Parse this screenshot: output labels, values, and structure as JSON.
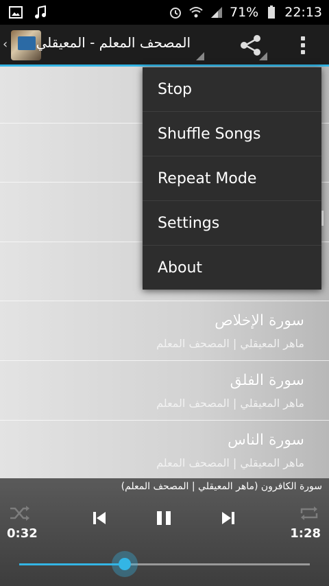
{
  "status_bar": {
    "battery_percent": "71%",
    "time": "22:13",
    "icons": [
      "image-icon",
      "music-note-icon",
      "alarm-icon",
      "wifi-icon",
      "signal-icon",
      "battery-icon"
    ]
  },
  "action_bar": {
    "title": "المصحف المعلم - المعيقلي",
    "share_icon": "share-icon",
    "overflow_icon": "overflow-menu-icon"
  },
  "overflow_menu": {
    "items": [
      {
        "label": "Stop"
      },
      {
        "label": "Shuffle Songs"
      },
      {
        "label": "Repeat Mode"
      },
      {
        "label": "Settings"
      },
      {
        "label": "About"
      }
    ]
  },
  "songs": [
    {
      "name": "سورة الإخلاص",
      "artist": "ماهر المعيقلي | المصحف المعلم"
    },
    {
      "name": "سورة الفلق",
      "artist": "ماهر المعيقلي | المصحف المعلم"
    },
    {
      "name": "سورة الناس",
      "artist": "ماهر المعيقلي | المصحف المعلم"
    }
  ],
  "player": {
    "now_playing": "سورة الكافرون (ماهر المعيقلي | المصحف المعلم)",
    "elapsed": "0:32",
    "duration": "1:28",
    "progress_fraction": 0.364,
    "accent_color": "#33b5e5"
  }
}
